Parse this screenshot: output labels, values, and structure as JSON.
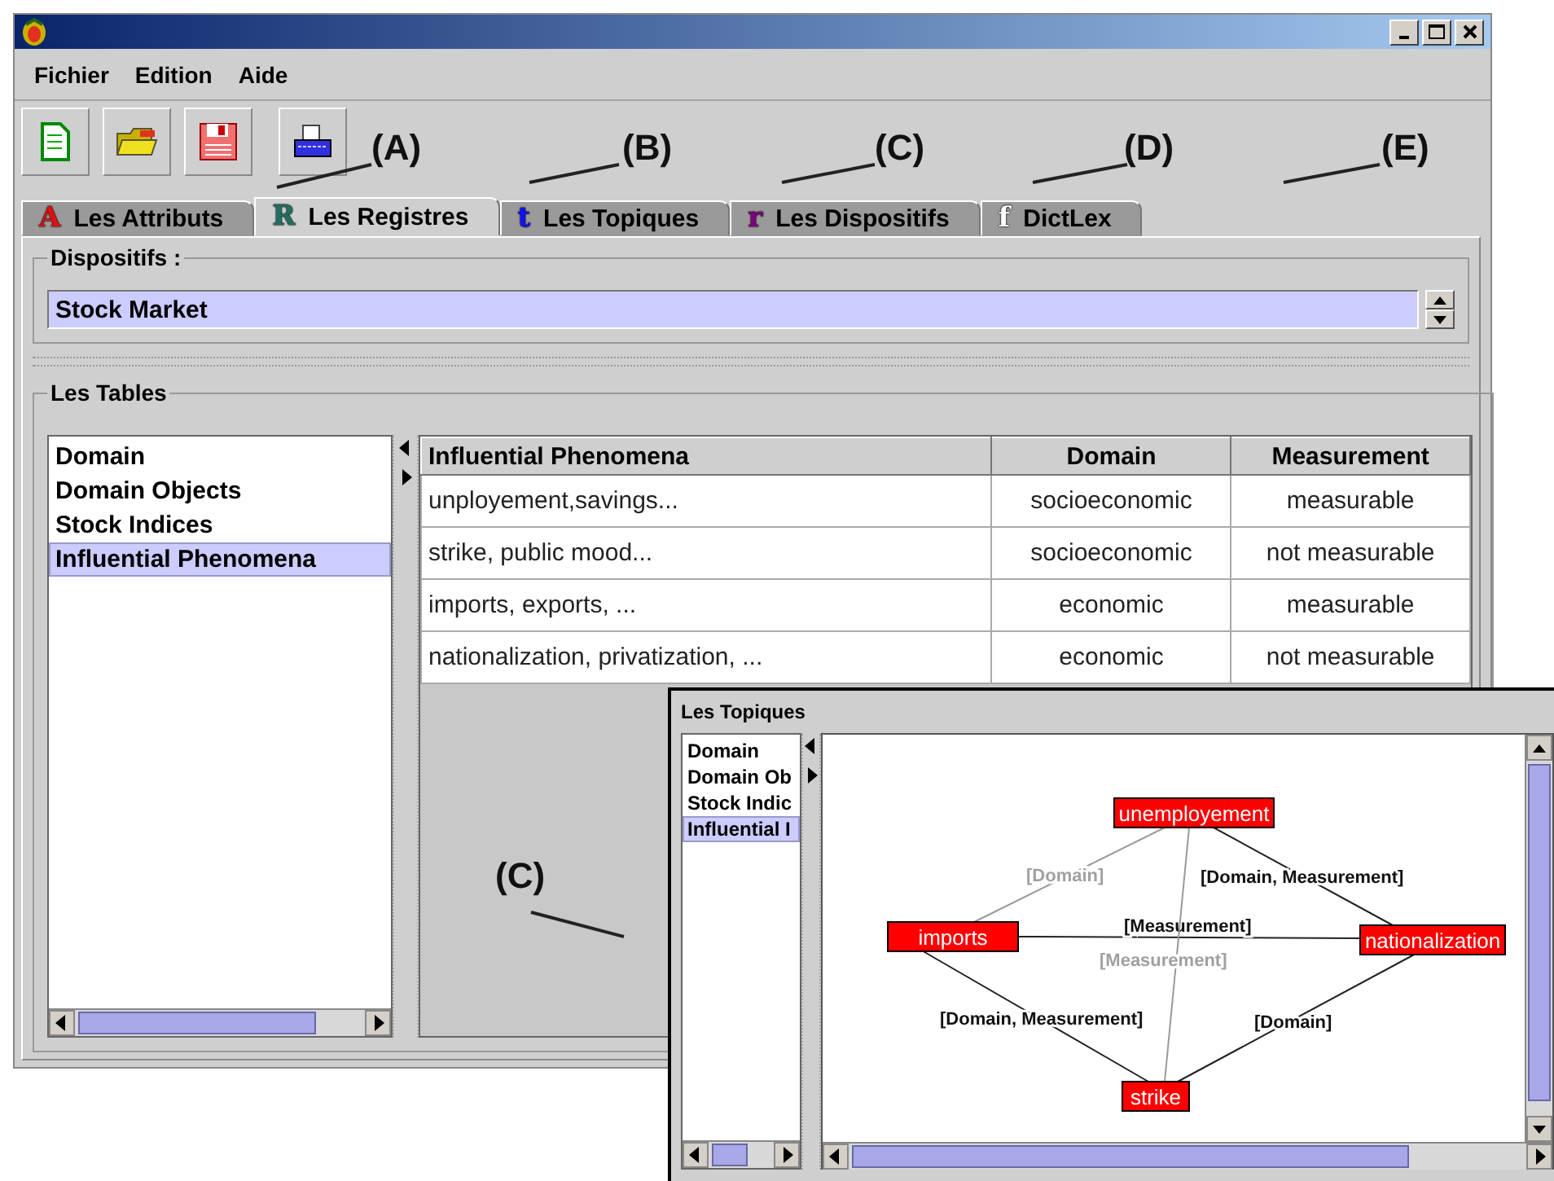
{
  "menu": [
    "Fichier",
    "Edition",
    "Aide"
  ],
  "tabs": [
    {
      "glyph": "A",
      "label": "Les Attributs",
      "color": "#e01010",
      "selected": false
    },
    {
      "glyph": "R",
      "label": "Les Registres",
      "color": "#207060",
      "selected": true
    },
    {
      "glyph": "t",
      "label": "Les Topiques",
      "color": "#1010ff",
      "selected": false
    },
    {
      "glyph": "r",
      "label": "Les Dispositifs",
      "color": "#800080",
      "selected": false
    },
    {
      "glyph": "f",
      "label": "DictLex",
      "color": "#ffffff",
      "selected": false
    }
  ],
  "dispositifs": {
    "label": "Dispositifs :",
    "value": "Stock Market"
  },
  "tables": {
    "title": "Les Tables",
    "items": [
      {
        "label": "Domain",
        "selected": false
      },
      {
        "label": "Domain Objects",
        "selected": false
      },
      {
        "label": "Stock Indices",
        "selected": false
      },
      {
        "label": "Influential Phenomena",
        "selected": true
      }
    ],
    "columns": [
      "Influential Phenomena",
      "Domain",
      "Measurement"
    ],
    "rows": [
      [
        "unployement,savings...",
        "socioeconomic",
        "measurable"
      ],
      [
        "strike, public mood...",
        "socioeconomic",
        "not measurable"
      ],
      [
        "imports, exports, ...",
        "economic",
        "measurable"
      ],
      [
        "nationalization, privatization, ...",
        "economic",
        "not measurable"
      ]
    ]
  },
  "topiques": {
    "title": "Les Topiques",
    "items": [
      {
        "label": "Domain",
        "selected": false
      },
      {
        "label": "Domain Ob",
        "selected": false
      },
      {
        "label": "Stock Indic",
        "selected": false
      },
      {
        "label": "Influential I",
        "selected": true
      }
    ],
    "nodes": [
      "unemployement",
      "imports",
      "nationalization",
      "strike"
    ],
    "edges": [
      {
        "label": "[Domain]",
        "faint": true
      },
      {
        "label": "[Domain, Measurement]",
        "faint": false
      },
      {
        "label": "[Measurement]",
        "faint": false
      },
      {
        "label": "[Measurement]",
        "faint": true
      },
      {
        "label": "[Domain, Measurement]",
        "faint": false
      },
      {
        "label": "[Domain]",
        "faint": false
      }
    ]
  },
  "annotations": [
    "(A)",
    "(B)",
    "(C)",
    "(D)",
    "(E)",
    "(C)"
  ]
}
